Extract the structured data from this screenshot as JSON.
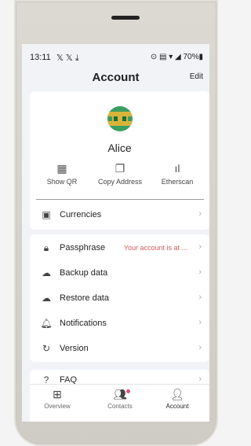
{
  "status": {
    "time": "13:11",
    "notifications": "𝕏 𝕏 ⤓",
    "right": "⊙ ▤ ▾ ◢ 70%▮"
  },
  "header": {
    "title": "Account",
    "edit": "Edit"
  },
  "profile": {
    "name": "Alice",
    "actions": [
      {
        "label": "Show QR",
        "icon": "qr-icon"
      },
      {
        "label": "Copy Address",
        "icon": "copy-icon"
      },
      {
        "label": "Etherscan",
        "icon": "chart-icon"
      }
    ],
    "currencies": "Currencies"
  },
  "settings": {
    "passphrase": {
      "label": "Passphrase",
      "warning": "Your account is at ..."
    },
    "items": [
      "Backup data",
      "Restore data",
      "Notifications",
      "Version"
    ]
  },
  "faq": "FAQ",
  "tabs": [
    "Overview",
    "Contacts",
    "Account"
  ],
  "colors": {
    "warning": "#d85a5a",
    "badge": "#e24f78"
  }
}
